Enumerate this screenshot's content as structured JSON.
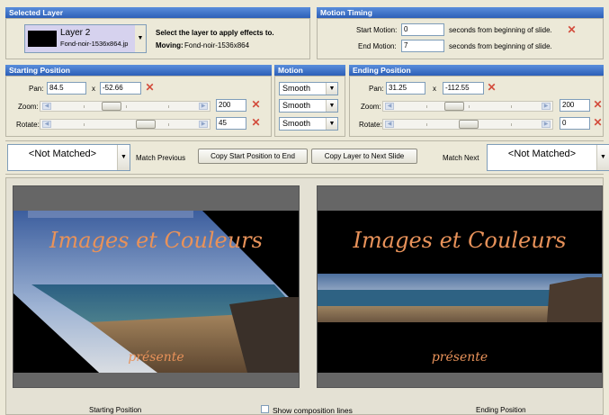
{
  "selected_layer": {
    "header": "Selected Layer",
    "layer_name": "Layer  2",
    "layer_file": "Fond-noir-1536x864.jp",
    "instruction": "Select the layer to apply effects to.",
    "moving_label": "Moving:",
    "moving_value": "Fond-noir-1536x864"
  },
  "motion_timing": {
    "header": "Motion Timing",
    "start_label": "Start Motion:",
    "start_value": "0",
    "start_suffix": "seconds from beginning of slide.",
    "end_label": "End Motion:",
    "end_value": "7",
    "end_suffix": "seconds from beginning of slide."
  },
  "starting_position": {
    "header": "Starting Position",
    "pan_label": "Pan:",
    "pan_x": "84.5",
    "pan_sep": "x",
    "pan_y": "-52.66",
    "zoom_label": "Zoom:",
    "zoom_value": "200",
    "rotate_label": "Rotate:",
    "rotate_value": "45"
  },
  "motion": {
    "header": "Motion",
    "pan_style": "Smooth",
    "zoom_style": "Smooth",
    "rotate_style": "Smooth"
  },
  "ending_position": {
    "header": "Ending Position",
    "pan_label": "Pan:",
    "pan_x": "31.25",
    "pan_sep": "x",
    "pan_y": "-112.55",
    "zoom_label": "Zoom:",
    "zoom_value": "200",
    "rotate_label": "Rotate:",
    "rotate_value": "0"
  },
  "match_bar": {
    "match_previous_value": "<Not Matched>",
    "match_previous_label": "Match Previous",
    "copy_start_to_end": "Copy Start Position to End",
    "copy_layer_next": "Copy Layer to Next Slide",
    "match_next_label": "Match Next",
    "match_next_value": "<Not Matched>"
  },
  "previews": {
    "title": "Images et Couleurs",
    "subtitle": "présente",
    "start_caption": "Starting Position",
    "show_lines_label": "Show composition lines",
    "end_caption": "Ending Position"
  },
  "colors": {
    "header_blue": "#2c5fb8",
    "remove_red": "#d34c3c",
    "title_orange": "#e8925a"
  }
}
